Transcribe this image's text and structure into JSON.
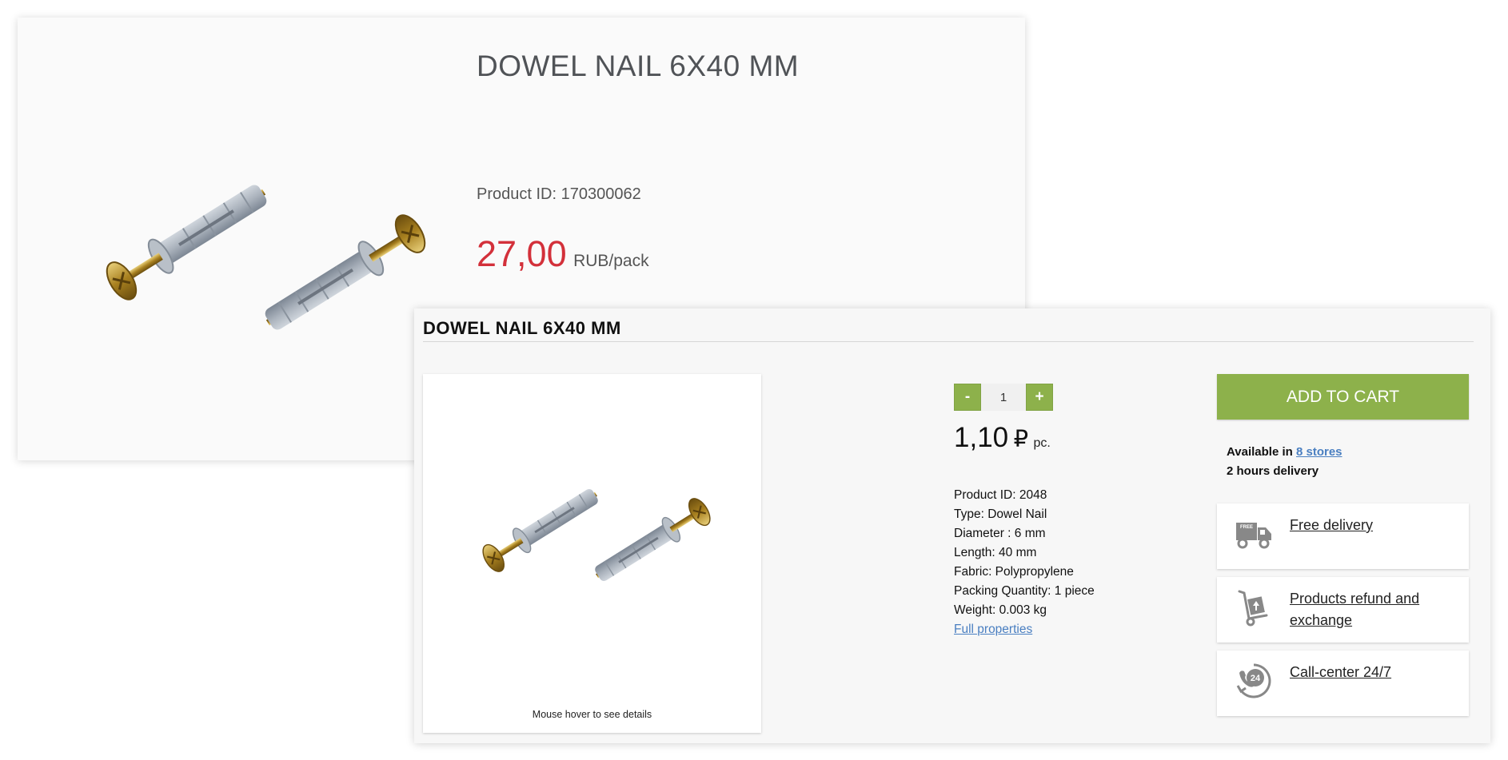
{
  "card_top": {
    "title": "DOWEL NAIL 6X40 MM",
    "product_id": "Product ID: 170300062",
    "price_value": "27,00",
    "price_unit": "RUB/pack",
    "price_color": "#d3303a"
  },
  "card_bottom": {
    "title": "DOWEL NAIL 6X40 MM",
    "image_hint": "Mouse hover to see details",
    "stepper": {
      "minus": "-",
      "quantity": "1",
      "plus": "+"
    },
    "price": {
      "value": "1,10",
      "currency": "₽",
      "unit": "pc."
    },
    "specs": [
      "Product ID: 2048",
      "Type: Dowel Nail",
      "Diameter : 6 mm",
      "Length: 40 mm",
      "Fabric: Polypropylene",
      "Packing Quantity: 1 piece",
      "Weight: 0.003 kg"
    ],
    "full_properties_link": "Full properties",
    "add_to_cart": "ADD TO CART",
    "availability": {
      "prefix": "Available in",
      "stores_link": "8 stores",
      "delivery": "2 hours delivery"
    },
    "services": [
      {
        "label": "Free delivery",
        "icon": "delivery-truck-icon",
        "badge": "FREE"
      },
      {
        "label": "Products refund and exchange",
        "icon": "hand-truck-box-icon"
      },
      {
        "label": "Call-center 24/7",
        "icon": "phone-24-icon",
        "badge": "24"
      }
    ],
    "accent_color": "#8db14b",
    "link_color": "#4a7fc1"
  }
}
